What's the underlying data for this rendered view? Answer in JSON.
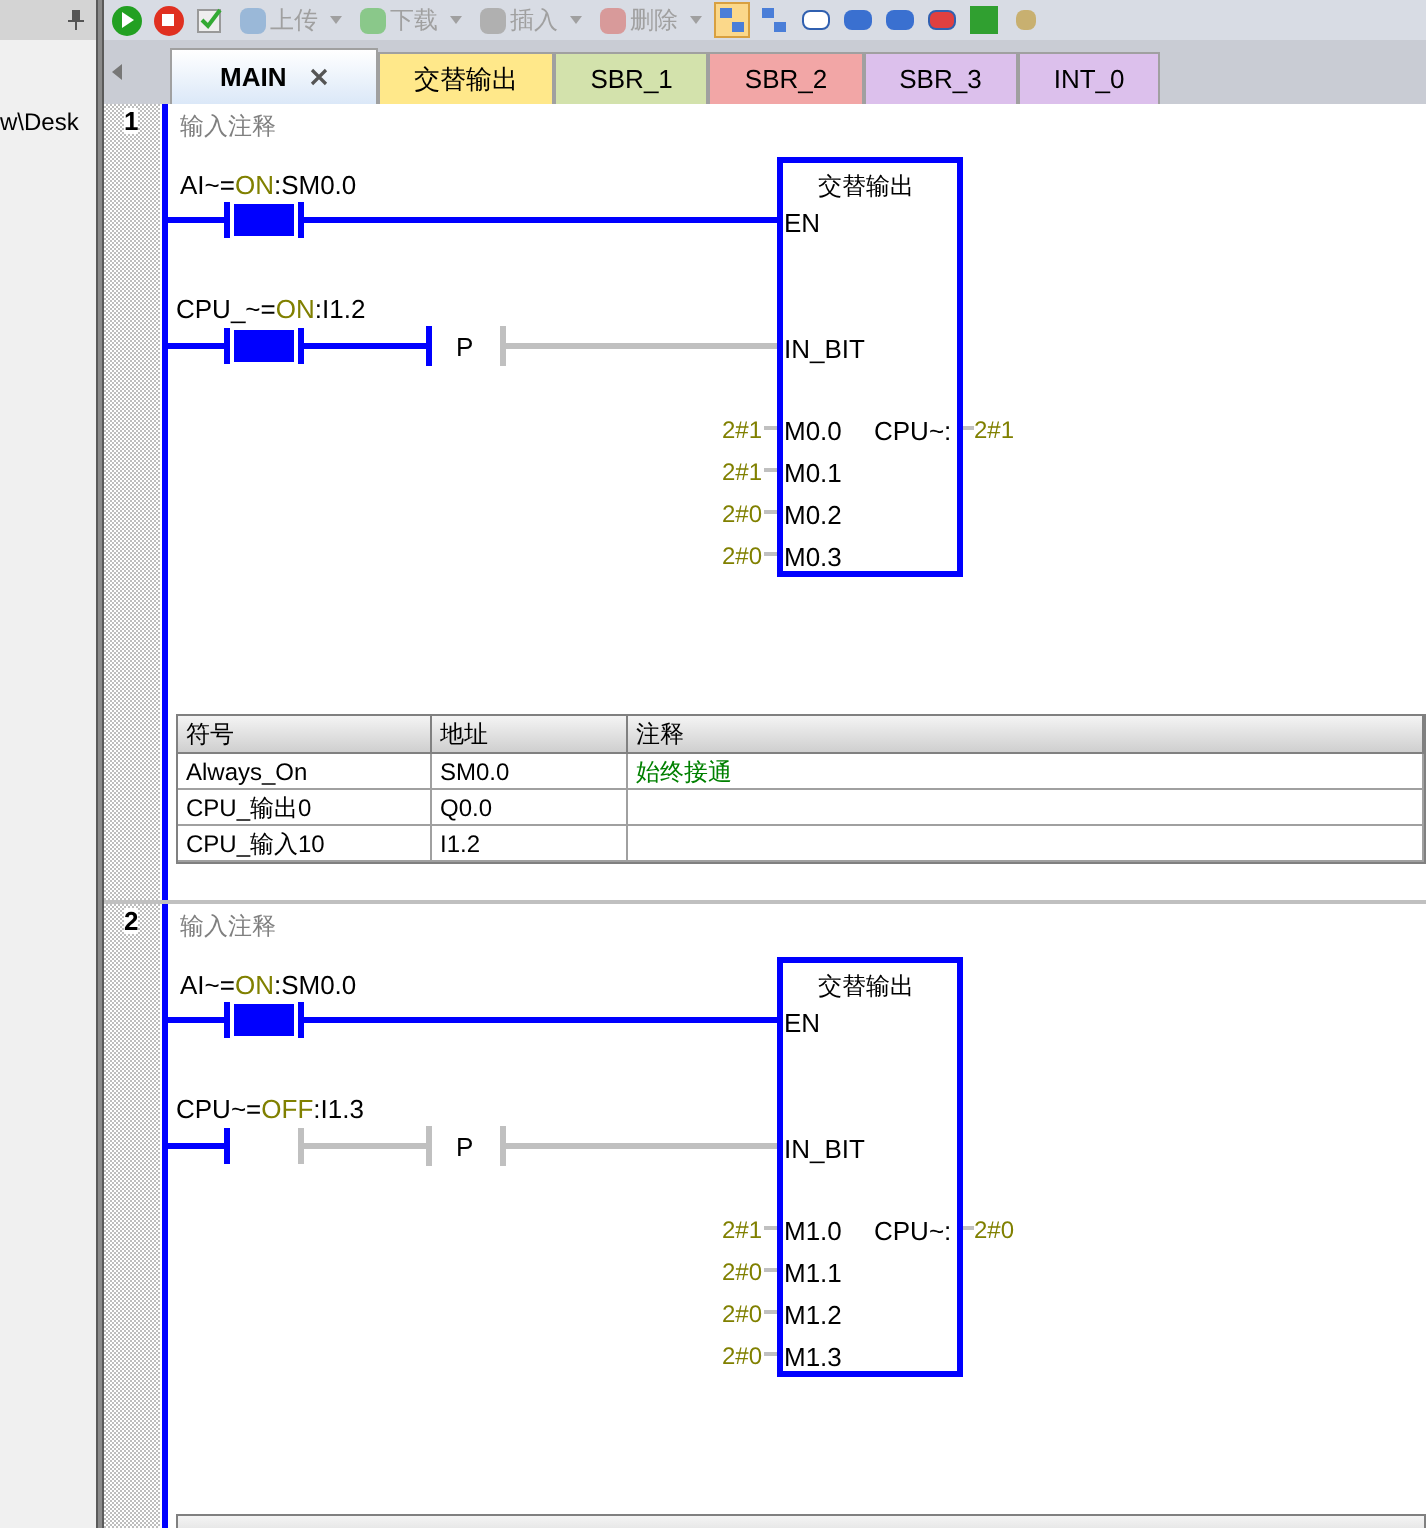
{
  "side_panel": {
    "path_text": "w\\Desk"
  },
  "toolbar": [
    {
      "label": "上传",
      "disabled": true
    },
    {
      "label": "下载",
      "disabled": true
    },
    {
      "label": "插入",
      "disabled": true
    },
    {
      "label": "删除",
      "disabled": true
    }
  ],
  "tabs": [
    {
      "label": "MAIN",
      "selected": true,
      "closable": true,
      "color": "#dbe8f8"
    },
    {
      "label": "交替输出",
      "selected": false,
      "closable": false,
      "color": "#ffe88a"
    },
    {
      "label": "SBR_1",
      "selected": false,
      "closable": false,
      "color": "#d3e2ac"
    },
    {
      "label": "SBR_2",
      "selected": false,
      "closable": false,
      "color": "#f2a6a6"
    },
    {
      "label": "SBR_3",
      "selected": false,
      "closable": false,
      "color": "#dcc0ec"
    },
    {
      "label": "INT_0",
      "selected": false,
      "closable": false,
      "color": "#dcc0ec"
    }
  ],
  "networks": [
    {
      "number": "1",
      "comment": "输入注释",
      "contacts": [
        {
          "name": "AI~=",
          "state": "ON",
          "address": ":SM0.0",
          "energized": true
        },
        {
          "name": "CPU_~=",
          "state": "ON",
          "address": ":I1.2",
          "energized": true
        }
      ],
      "edge": "P",
      "block": {
        "title": "交替输出",
        "en": "EN",
        "in": "IN_BIT",
        "inputs": [
          {
            "value": "2#1",
            "pin": "M0.0"
          },
          {
            "value": "2#1",
            "pin": "M0.1"
          },
          {
            "value": "2#0",
            "pin": "M0.2"
          },
          {
            "value": "2#0",
            "pin": "M0.3"
          }
        ],
        "output_pin": "CPU~:",
        "output_value": "2#1"
      },
      "symbol_table": {
        "columns": [
          "符号",
          "地址",
          "注释"
        ],
        "rows": [
          [
            "Always_On",
            "SM0.0",
            "始终接通"
          ],
          [
            "CPU_输出0",
            "Q0.0",
            ""
          ],
          [
            "CPU_输入10",
            "I1.2",
            ""
          ]
        ]
      }
    },
    {
      "number": "2",
      "comment": "输入注释",
      "contacts": [
        {
          "name": "AI~=",
          "state": "ON",
          "address": ":SM0.0",
          "energized": true
        },
        {
          "name": "CPU~=",
          "state": "OFF",
          "address": ":I1.3",
          "energized": false
        }
      ],
      "edge": "P",
      "block": {
        "title": "交替输出",
        "en": "EN",
        "in": "IN_BIT",
        "inputs": [
          {
            "value": "2#1",
            "pin": "M1.0"
          },
          {
            "value": "2#0",
            "pin": "M1.1"
          },
          {
            "value": "2#0",
            "pin": "M1.2"
          },
          {
            "value": "2#0",
            "pin": "M1.3"
          }
        ],
        "output_pin": "CPU~:",
        "output_value": "2#0"
      }
    }
  ]
}
